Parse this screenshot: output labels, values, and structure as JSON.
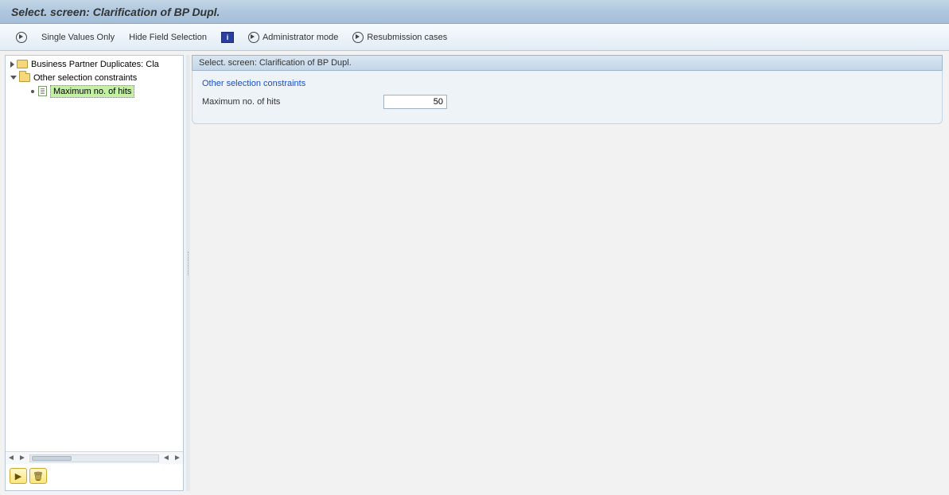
{
  "title": "Select. screen: Clarification of BP Dupl.",
  "toolbar": {
    "single_values": "Single Values Only",
    "hide_field": "Hide Field Selection",
    "admin_mode": "Administrator mode",
    "resubmission": "Resubmission cases"
  },
  "tree": {
    "node_bp_dup": "Business Partner Duplicates: Cla",
    "node_other_constraints": "Other selection constraints",
    "node_max_hits": "Maximum no. of hits"
  },
  "panel": {
    "header": "Select. screen: Clarification of BP Dupl.",
    "group_label": "Other selection constraints",
    "max_hits_label": "Maximum no. of hits",
    "max_hits_value": "50"
  },
  "icons": {
    "blue_i": "i",
    "execute_glyph": "▶",
    "trash_glyph": "🗑"
  }
}
